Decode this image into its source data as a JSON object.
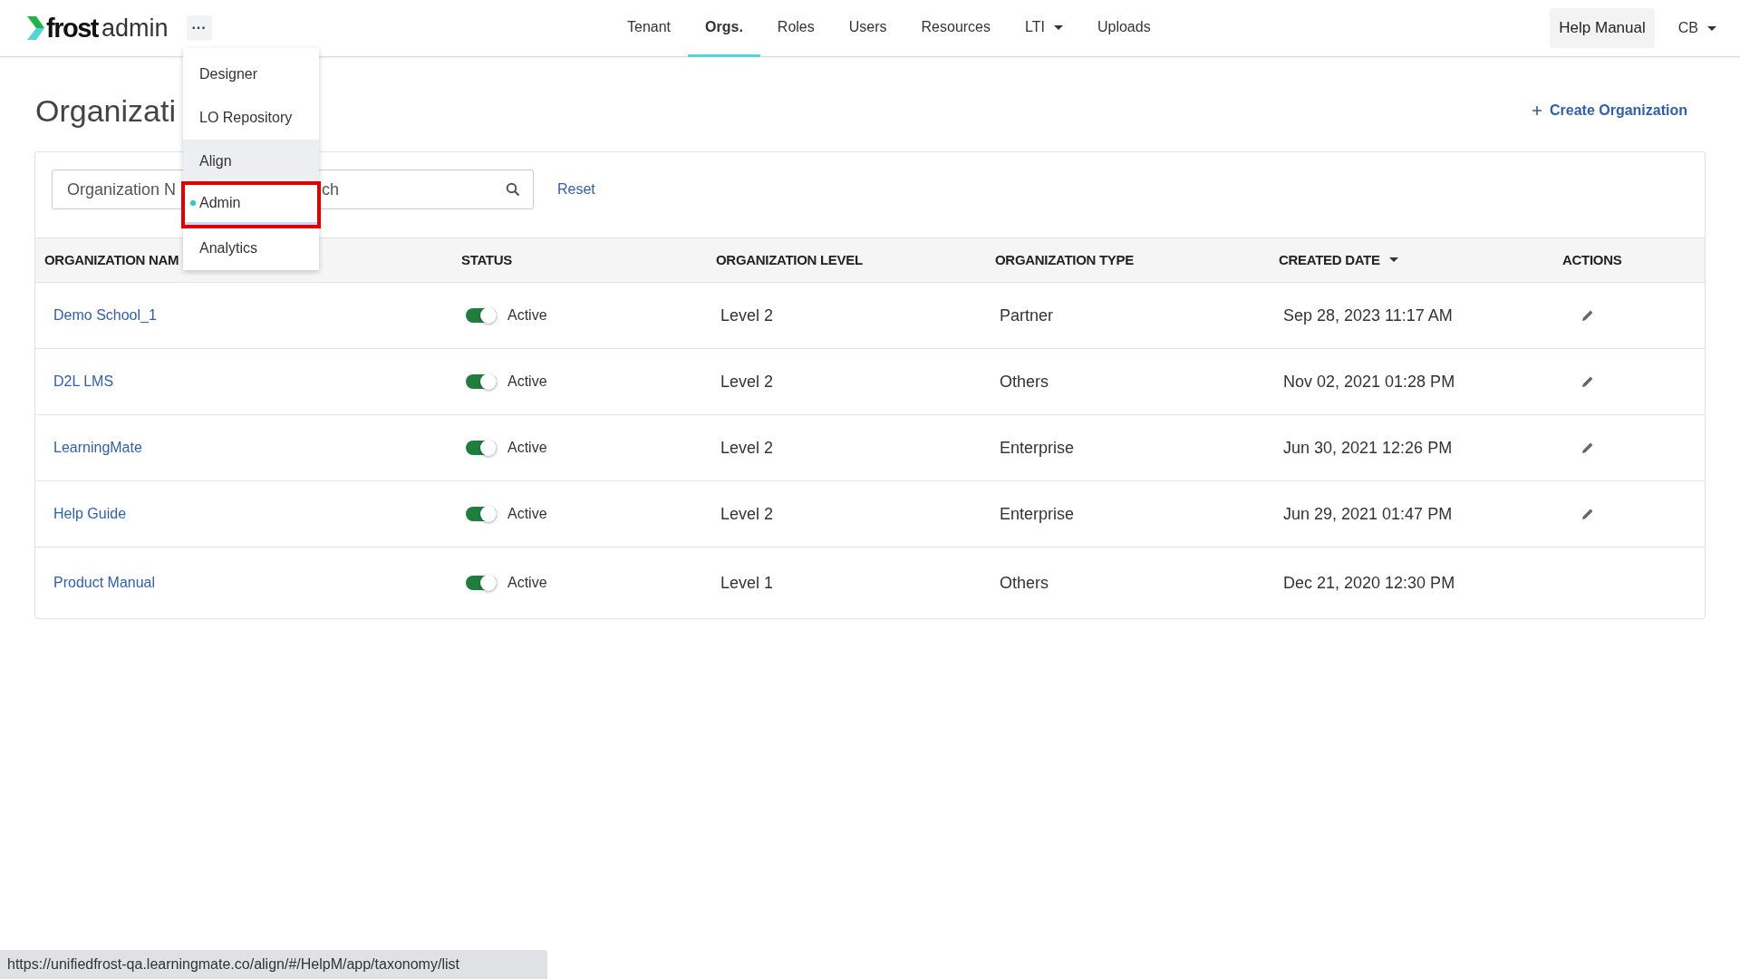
{
  "header": {
    "logo": {
      "brand": "frost",
      "product": "admin"
    },
    "apps_button": "···",
    "nav": [
      {
        "label": "Tenant",
        "selected": false,
        "dropdown": false
      },
      {
        "label": "Orgs.",
        "selected": true,
        "dropdown": false
      },
      {
        "label": "Roles",
        "selected": false,
        "dropdown": false
      },
      {
        "label": "Users",
        "selected": false,
        "dropdown": false
      },
      {
        "label": "Resources",
        "selected": false,
        "dropdown": false
      },
      {
        "label": "LTI",
        "selected": false,
        "dropdown": true
      },
      {
        "label": "Uploads",
        "selected": false,
        "dropdown": false
      }
    ],
    "help_button": "Help Manual",
    "user_menu": "CB"
  },
  "apps_menu": [
    {
      "label": "Designer",
      "selected": false,
      "hovered": false,
      "highlighted": false
    },
    {
      "label": "LO Repository",
      "selected": false,
      "hovered": false,
      "highlighted": false
    },
    {
      "label": "Align",
      "selected": false,
      "hovered": true,
      "highlighted": false
    },
    {
      "label": "Admin",
      "selected": true,
      "hovered": false,
      "highlighted": true
    },
    {
      "label": "Analytics",
      "selected": false,
      "hovered": false,
      "highlighted": false
    }
  ],
  "page": {
    "title": "Organizati",
    "create_button": "Create Organization"
  },
  "search": {
    "placeholder_start": "Organization N",
    "placeholder_end": "ch",
    "reset": "Reset"
  },
  "table": {
    "columns": [
      {
        "label": "ORGANIZATION NAM",
        "sorted": false
      },
      {
        "label": "STATUS",
        "sorted": false
      },
      {
        "label": "ORGANIZATION LEVEL",
        "sorted": false
      },
      {
        "label": "ORGANIZATION TYPE",
        "sorted": false
      },
      {
        "label": "CREATED DATE",
        "sorted": true
      },
      {
        "label": "ACTIONS",
        "sorted": false
      }
    ],
    "rows": [
      {
        "name": "Demo School_1",
        "on": true,
        "status": "Active",
        "level": "Level 2",
        "type": "Partner",
        "created": "Sep 28, 2023 11:17 AM",
        "actions": [
          {
            "kind": "edit"
          }
        ]
      },
      {
        "name": "D2L LMS",
        "on": true,
        "status": "Active",
        "level": "Level 2",
        "type": "Others",
        "created": "Nov 02, 2021 01:28 PM",
        "actions": [
          {
            "kind": "edit"
          }
        ]
      },
      {
        "name": "LearningMate",
        "on": true,
        "status": "Active",
        "level": "Level 2",
        "type": "Enterprise",
        "created": "Jun 30, 2021 12:26 PM",
        "actions": [
          {
            "kind": "edit"
          }
        ]
      },
      {
        "name": "Help Guide",
        "on": true,
        "status": "Active",
        "level": "Level 2",
        "type": "Enterprise",
        "created": "Jun 29, 2021 01:47 PM",
        "actions": [
          {
            "kind": "edit"
          }
        ]
      },
      {
        "name": "Product Manual",
        "on": true,
        "status": "Active",
        "level": "Level 1",
        "type": "Others",
        "created": "Dec 21, 2020 12:30 PM"
      }
    ]
  },
  "status_bar": "https://unifiedfrost-qa.learningmate.co/align/#/HelpM/app/taxonomy/list"
}
